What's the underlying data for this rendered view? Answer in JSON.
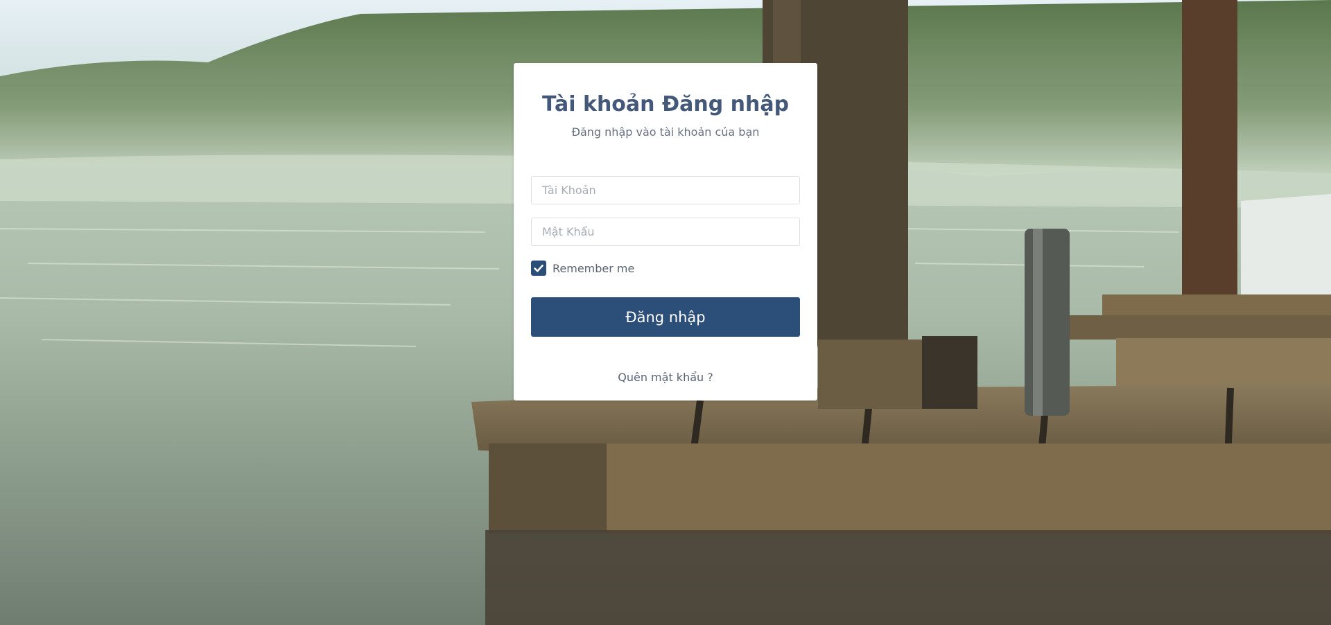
{
  "page": {
    "title": "Tài khoản Đăng nhập",
    "subtitle": "Đăng nhập vào tài khoản của bạn"
  },
  "form": {
    "username_placeholder": "Tài Khoản",
    "username_value": "",
    "password_placeholder": "Mật Khẩu",
    "password_value": "",
    "remember_label": "Remember me",
    "remember_checked": true,
    "submit_label": "Đăng nhập",
    "forgot_label": "Quên mật khẩu ?"
  },
  "colors": {
    "primary": "#2c4f79",
    "title": "#44587a",
    "text_muted": "#66717f",
    "card_bg": "#ffffff"
  },
  "icons": {
    "remember_check": "check-icon"
  }
}
